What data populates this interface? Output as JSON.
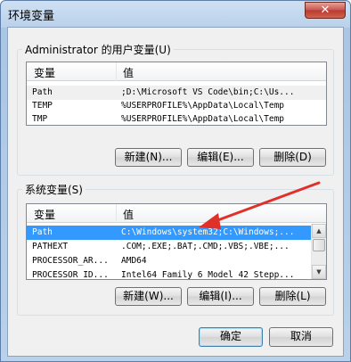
{
  "window": {
    "title": "环境变量",
    "close_label": "✕"
  },
  "user_vars": {
    "group_label": "Administrator 的用户变量(U)",
    "columns": [
      "变量",
      "值"
    ],
    "rows": [
      {
        "name": "Path",
        "value": ";D:\\Microsoft VS Code\\bin;C:\\Us..."
      },
      {
        "name": "TEMP",
        "value": "%USERPROFILE%\\AppData\\Local\\Temp"
      },
      {
        "name": "TMP",
        "value": "%USERPROFILE%\\AppData\\Local\\Temp"
      }
    ],
    "buttons": {
      "new": "新建(N)...",
      "edit": "编辑(E)...",
      "delete": "删除(D)"
    }
  },
  "system_vars": {
    "group_label": "系统变量(S)",
    "columns": [
      "变量",
      "值"
    ],
    "rows": [
      {
        "name": "Path",
        "value": "C:\\Windows\\system32;C:\\Windows;...",
        "selected": true
      },
      {
        "name": "PATHEXT",
        "value": ".COM;.EXE;.BAT;.CMD;.VBS;.VBE;..."
      },
      {
        "name": "PROCESSOR_AR...",
        "value": "AMD64"
      },
      {
        "name": "PROCESSOR_ID...",
        "value": "Intel64 Family 6 Model 42 Stepp..."
      }
    ],
    "buttons": {
      "new": "新建(W)...",
      "edit": "编辑(I)...",
      "delete": "删除(L)"
    }
  },
  "footer": {
    "ok": "确定",
    "cancel": "取消"
  },
  "colors": {
    "selection": "#3399ff",
    "annotation_arrow": "#e0302a",
    "titlebar_close": "#c75050"
  }
}
